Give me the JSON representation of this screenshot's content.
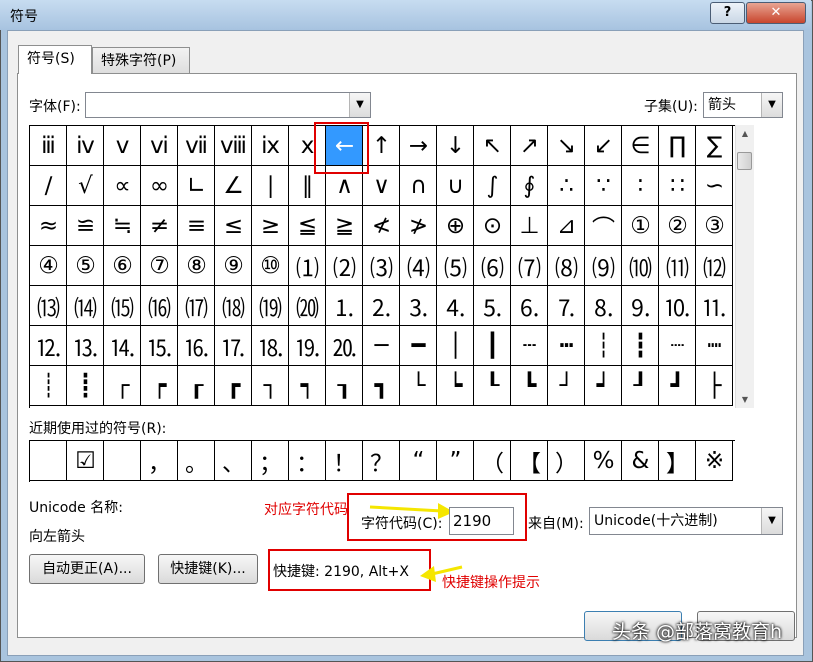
{
  "window": {
    "title": "符号",
    "help_label": "?",
    "close_label": "✕"
  },
  "tabs": [
    {
      "label": "符号(S)"
    },
    {
      "label": "特殊字符(P)"
    }
  ],
  "font": {
    "label": "字体(F):",
    "value": ""
  },
  "subset": {
    "label": "子集(U):",
    "value": "箭头"
  },
  "symbols": [
    "ⅲ",
    "ⅳ",
    "ⅴ",
    "ⅵ",
    "ⅶ",
    "ⅷ",
    "ⅸ",
    "ⅹ",
    "←",
    "↑",
    "→",
    "↓",
    "↖",
    "↗",
    "↘",
    "↙",
    "∈",
    "∏",
    "∑",
    "∕",
    "√",
    "∝",
    "∞",
    "∟",
    "∠",
    "∣",
    "∥",
    "∧",
    "∨",
    "∩",
    "∪",
    "∫",
    "∮",
    "∴",
    "∵",
    "∶",
    "∷",
    "∽",
    "≈",
    "≌",
    "≒",
    "≠",
    "≡",
    "≤",
    "≥",
    "≦",
    "≧",
    "≮",
    "≯",
    "⊕",
    "⊙",
    "⊥",
    "⊿",
    "⌒",
    "①",
    "②",
    "③",
    "④",
    "⑤",
    "⑥",
    "⑦",
    "⑧",
    "⑨",
    "⑩",
    "⑴",
    "⑵",
    "⑶",
    "⑷",
    "⑸",
    "⑹",
    "⑺",
    "⑻",
    "⑼",
    "⑽",
    "⑾",
    "⑿",
    "⒀",
    "⒁",
    "⒂",
    "⒃",
    "⒄",
    "⒅",
    "⒆",
    "⒇",
    "⒈",
    "⒉",
    "⒊",
    "⒋",
    "⒌",
    "⒍",
    "⒎",
    "⒏",
    "⒐",
    "⒑",
    "⒒",
    "⒓",
    "⒔",
    "⒕",
    "⒖",
    "⒗",
    "⒘",
    "⒙",
    "⒚",
    "⒛",
    "─",
    "━",
    "│",
    "┃",
    "┄",
    "┅",
    "┆",
    "┇",
    "┈",
    "┉",
    "┊",
    "┋",
    "┌",
    "┍",
    "┎",
    "┏",
    "┐",
    "┑",
    "┒",
    "┓",
    "└",
    "┕",
    "┖",
    "┗",
    "┘",
    "┙",
    "┚",
    "┛",
    "├"
  ],
  "selected_symbol": "←",
  "recent": {
    "label": "近期使用过的符号(R):",
    "symbols": [
      "",
      "☑",
      "",
      "，",
      "。",
      "、",
      "；",
      "：",
      "！",
      "？",
      "“",
      "”",
      "（",
      "【",
      "）",
      "%",
      "&",
      "】",
      "※"
    ]
  },
  "unicode_name": {
    "label": "Unicode 名称:",
    "value": "向左箭头"
  },
  "char_code": {
    "label": "字符代码(C):",
    "value": "2190"
  },
  "from": {
    "label": "来自(M):",
    "value": "Unicode(十六进制)"
  },
  "buttons": {
    "autocorrect": "自动更正(A)...",
    "shortcut": "快捷键(K)..."
  },
  "shortcut_text": "快捷键: 2190, Alt+X",
  "annotations": {
    "code": "对应字符代码",
    "shortcut": "快捷键操作提示"
  },
  "watermark": "头条 @部落窝教育h",
  "colors": {
    "selection": "#3399ff",
    "annotation_red": "#e00000",
    "arrow_yellow": "#f5e600"
  }
}
